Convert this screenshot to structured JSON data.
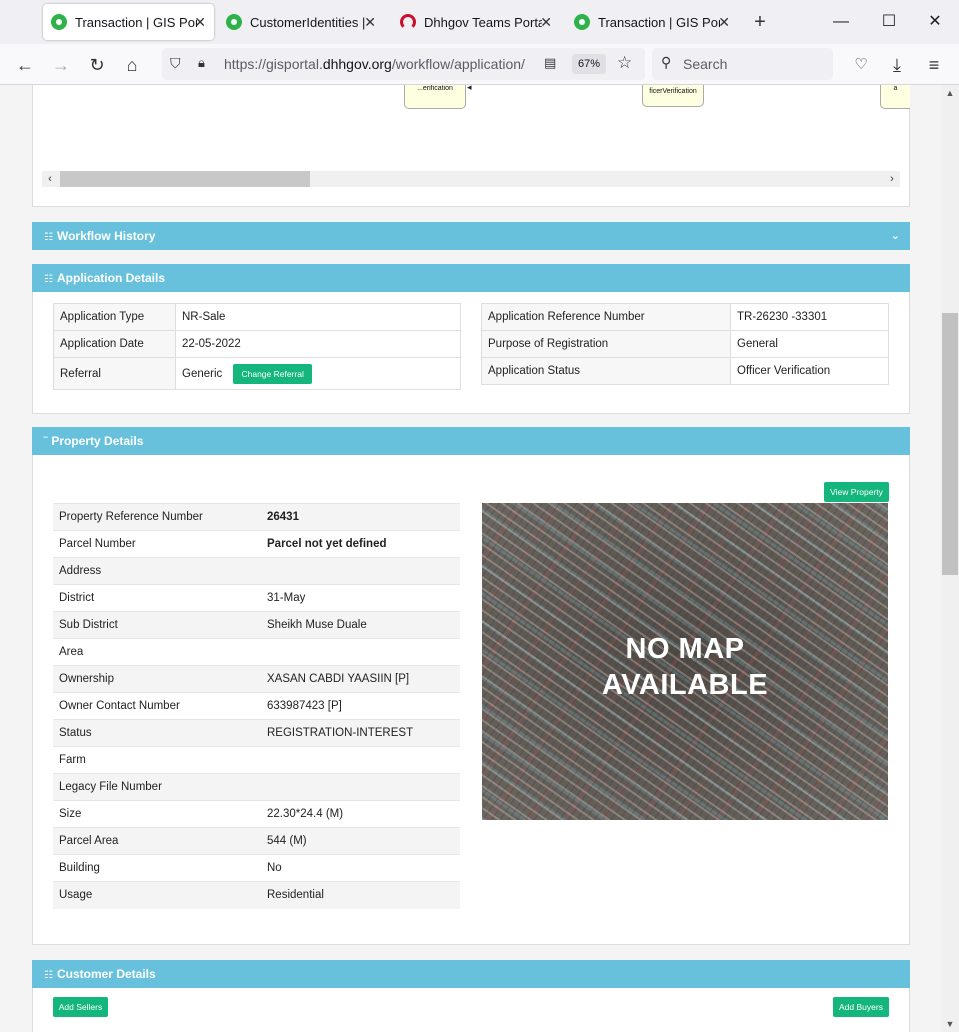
{
  "browser": {
    "tabs": [
      {
        "title": "Transaction | GIS Portal",
        "favicon_color": "#2fb24a",
        "active": true
      },
      {
        "title": "CustomerIdentities | GIS",
        "favicon_color": "#2fb24a",
        "active": false
      },
      {
        "title": "Dhhgov Teams Portal",
        "favicon_color": "#c8102e",
        "active": false
      },
      {
        "title": "Transaction | GIS Portal",
        "favicon_color": "#2fb24a",
        "active": false
      }
    ],
    "url_prefix": "https://gisportal.",
    "url_domain": "dhhgov.org",
    "url_path": "/workflow/application/",
    "zoom": "67%",
    "search_placeholder": "Search"
  },
  "workflow_diagram": {
    "nodes": [
      "...erification",
      "ficerVerification",
      "a"
    ]
  },
  "workflow_history": {
    "title": "Workflow History"
  },
  "application_details": {
    "title": "Application Details",
    "left": {
      "type_label": "Application Type",
      "type_value": "NR-Sale",
      "date_label": "Application Date",
      "date_value": "22-05-2022",
      "referral_label": "Referral",
      "referral_value": "Generic",
      "change_referral_button": "Change Referral"
    },
    "right": {
      "ref_label": "Application Reference Number",
      "ref_value": "TR-26230 -33301",
      "purpose_label": "Purpose of Registration",
      "purpose_value": "General",
      "status_label": "Application Status",
      "status_value": "Officer Verification"
    }
  },
  "property_details": {
    "title": "Property Details",
    "view_property_button": "View Property",
    "map_text_line1": "NO MAP",
    "map_text_line2": "AVAILABLE",
    "rows": [
      {
        "label": "Property Reference Number",
        "value": "26431"
      },
      {
        "label": "Parcel Number",
        "value": "Parcel not yet defined"
      },
      {
        "label": "Address",
        "value": ""
      },
      {
        "label": "District",
        "value": "31-May"
      },
      {
        "label": "Sub District",
        "value": "Sheikh Muse Duale"
      },
      {
        "label": "Area",
        "value": ""
      },
      {
        "label": "Ownership",
        "value": "XASAN CABDI YAASIIN [P]"
      },
      {
        "label": "Owner Contact Number",
        "value": "633987423 [P]"
      },
      {
        "label": "Status",
        "value": "REGISTRATION-INTEREST"
      },
      {
        "label": "Farm",
        "value": ""
      },
      {
        "label": "Legacy File Number",
        "value": ""
      },
      {
        "label": "Size",
        "value": "22.30*24.4 (M)"
      },
      {
        "label": "Parcel Area",
        "value": "544 (M)"
      },
      {
        "label": "Building",
        "value": "No"
      },
      {
        "label": "Usage",
        "value": "Residential"
      }
    ]
  },
  "customer_details": {
    "title": "Customer Details",
    "add_sellers_button": "Add Sellers",
    "add_buyers_button": "Add Buyers"
  },
  "colors": {
    "panel_header": "#67c1dc",
    "button_green": "#14b67e"
  }
}
